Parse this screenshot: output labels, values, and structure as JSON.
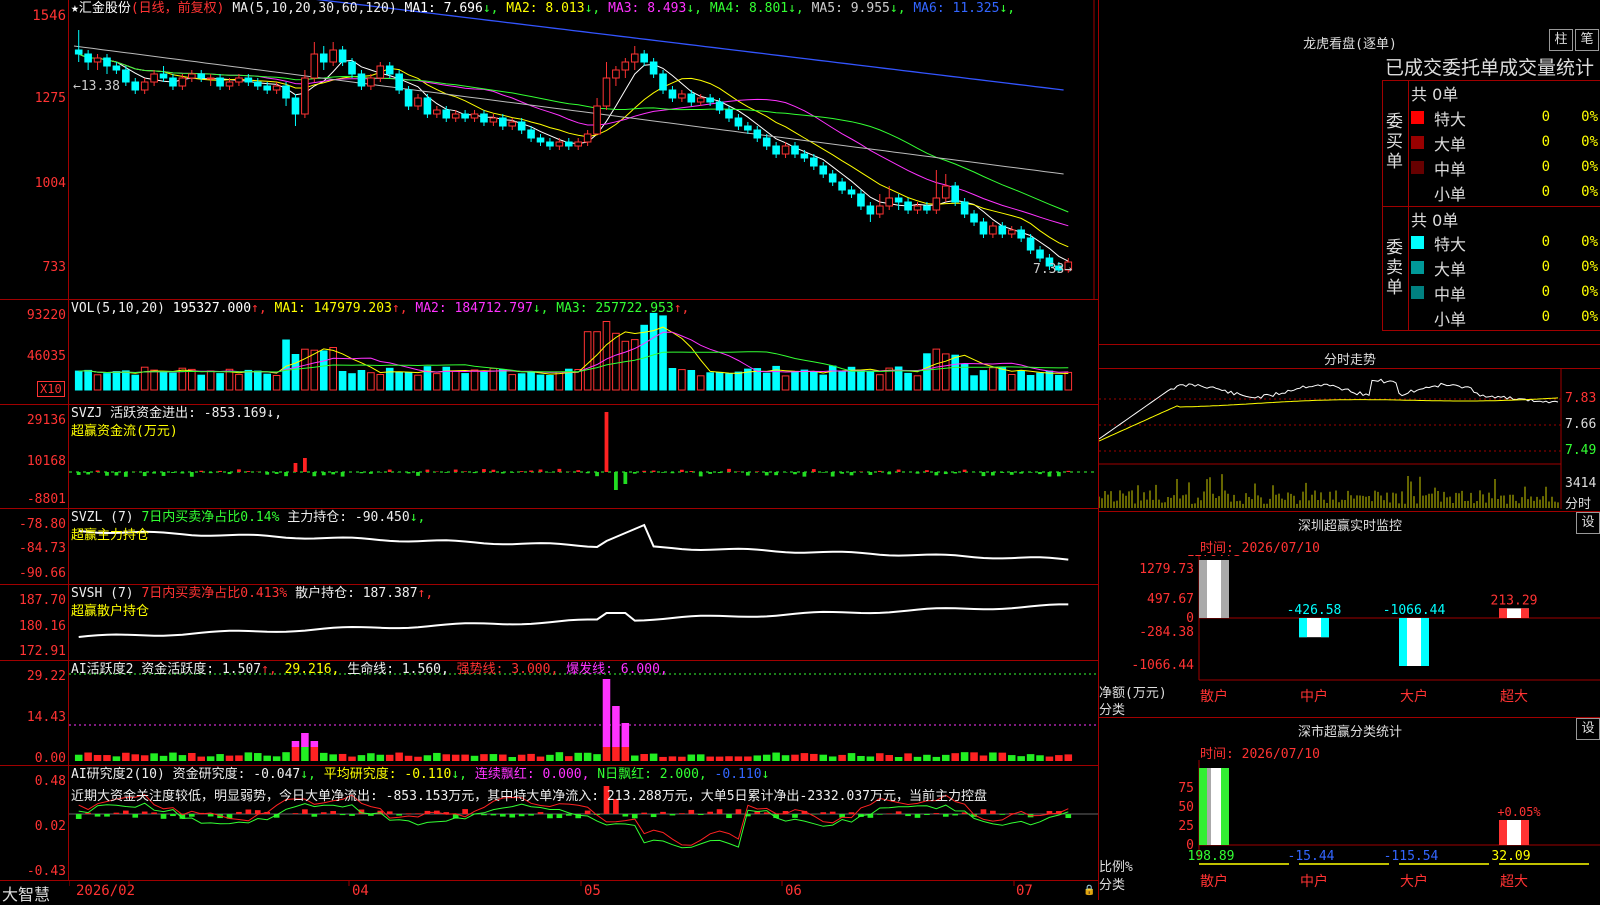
{
  "main_header": {
    "star": "★",
    "stock_name": "汇金股份",
    "period": "(日线，前复权)",
    "ma_params": "MA(5,10,20,30,60,120)",
    "ma": [
      {
        "label": "MA1: 7.696",
        "arrow": "↓",
        "color": "#ffffff"
      },
      {
        "label": "MA2: 8.013",
        "arrow": "↓",
        "color": "#ffff00"
      },
      {
        "label": "MA3: 8.493",
        "arrow": "↓",
        "color": "#ff33ff"
      },
      {
        "label": "MA4: 8.801",
        "arrow": "↓",
        "color": "#33ff33"
      },
      {
        "label": "MA5: 9.955",
        "arrow": "↓",
        "color": "#cccccc"
      },
      {
        "label": "MA6: 11.325",
        "arrow": "↓",
        "color": "#3366ff"
      }
    ],
    "y_ticks": [
      "1546",
      "1275",
      "1004",
      "733"
    ],
    "hi_label": "←13.38",
    "lo_label": "7.33→"
  },
  "vol_panel": {
    "title": "VOL(5,10,20)",
    "items": [
      {
        "label": " 195327.000",
        "arrow": "↑",
        "color": "#ffffff"
      },
      {
        "label": " MA1: 147979.203",
        "arrow": "↑",
        "color": "#ffff00"
      },
      {
        "label": " MA2: 184712.797",
        "arrow": "↓",
        "color": "#ff33ff"
      },
      {
        "label": " MA3: 257722.953",
        "arrow": "↑",
        "color": "#33ff33"
      }
    ],
    "y_ticks": [
      "93220",
      "46035"
    ],
    "unit": "X10"
  },
  "svzj_panel": {
    "title": "SVZJ  活跃资金进出: -853.169↓,",
    "subtitle": "超赢资金流(万元)",
    "y_ticks": [
      "29136",
      "10168",
      "-8801"
    ]
  },
  "svzl_panel": {
    "title_a": "SVZL (7) ",
    "title_b": "7日内买卖净占比0.14%",
    "title_c": " 主力持仓: -90.450",
    "arrow": "↓,",
    "subtitle": "超赢主力持仓",
    "y_ticks": [
      "-78.80",
      "-84.73",
      "-90.66"
    ]
  },
  "svsh_panel": {
    "title_a": "SVSH (7) ",
    "title_b": "7日内买卖净占比0.413%",
    "title_c": " 散户持仓: 187.387",
    "arrow": "↑,",
    "subtitle": "超赢散户持仓",
    "y_ticks": [
      "187.70",
      "180.16",
      "172.91"
    ]
  },
  "ai_active_panel": {
    "title": "AI活跃度2 资金活跃度: 1.507",
    "a1": "↑,",
    "v2": " 29.216,",
    "v3": " 生命线: 1.560,",
    "v4": " 强势线: 3.000,",
    "v5": " 爆发线: 6.000,",
    "y_ticks": [
      "29.22",
      "14.43",
      "0.00"
    ]
  },
  "ai_research_panel": {
    "title": "AI研究度2(10) 资金研究度: -0.047",
    "a1": "↓,",
    "p2": " 平均研究度: -0.110",
    "p3": " 连续飘红: 0.000,",
    "p4": " N日飘红: 2.000,",
    "p5": " -0.110",
    "summary": "近期大资金关注度较低，明显弱势，今日大单净流出: -853.153万元，其中特大单净流入: 213.288万元，大单5日累计净出-2332.037万元，当前主力控盘",
    "y_ticks": [
      "0.48",
      "0.02",
      "-0.43"
    ]
  },
  "x_axis": {
    "labels": [
      "2026/02",
      "04",
      "05",
      "06",
      "07"
    ],
    "brand": "大智慧"
  },
  "dragon_panel": {
    "title": "龙虎看盘(逐单)",
    "btn_pillar": "柱",
    "btn_pen": "笔",
    "subtitle": "已成交委托单成交量统计",
    "buy_label": "委买单",
    "sell_label": "委卖单",
    "buy_total": "共 0单",
    "sell_total": "共 0单",
    "buy_rows": [
      {
        "name": "特大",
        "count": "0",
        "pct": "0%",
        "color": "#ff0000"
      },
      {
        "name": "大单",
        "count": "0",
        "pct": "0%",
        "color": "#990000"
      },
      {
        "name": "中单",
        "count": "0",
        "pct": "0%",
        "color": "#660000"
      },
      {
        "name": "小单",
        "count": "0",
        "pct": "0%",
        "color": ""
      }
    ],
    "sell_rows": [
      {
        "name": "特大",
        "count": "0",
        "pct": "0%",
        "color": "#00ffff"
      },
      {
        "name": "大单",
        "count": "0",
        "pct": "0%",
        "color": "#009999"
      },
      {
        "name": "中单",
        "count": "0",
        "pct": "0%",
        "color": "#008080"
      },
      {
        "name": "小单",
        "count": "0",
        "pct": "0%",
        "color": ""
      }
    ]
  },
  "intraday_panel": {
    "title": "分时走势",
    "y_ticks": [
      "7.83",
      "7.66",
      "7.49"
    ],
    "vol_label": "3414",
    "vol_unit": "分时"
  },
  "monitor_panel": {
    "title": "深圳超赢实时监控",
    "settings": "设",
    "time_label": "时间: 2026/07/10",
    "y_ticks": [
      "1279.73",
      "497.67",
      "0",
      "-284.38",
      "-1066.44"
    ],
    "y_title": "净额(万元)",
    "x_title": "分类",
    "categories": [
      "散户",
      "中户",
      "大户",
      "超大"
    ],
    "values": [
      "1279.73",
      "-426.58",
      "-1066.44",
      "213.29"
    ]
  },
  "stats_panel": {
    "title": "深市超赢分类统计",
    "settings": "设",
    "time_label": "时间: 2026/07/10",
    "y_ticks": [
      "75",
      "50",
      "25",
      "0"
    ],
    "y_title": "比例%",
    "x_title": "分类",
    "categories": [
      "散户",
      "中户",
      "大户",
      "超大"
    ],
    "values": [
      "198.89",
      "-15.44",
      "-115.54",
      "32.09"
    ],
    "pct_label": "+0.05%"
  },
  "chart_data": {
    "type": "candlestick",
    "title": "汇金股份",
    "candles": [
      [
        12.9,
        12.8,
        13.4,
        12.6
      ],
      [
        12.8,
        12.6,
        12.9,
        12.4
      ],
      [
        12.6,
        12.7,
        12.8,
        12.4
      ],
      [
        12.7,
        12.5,
        12.8,
        12.3
      ],
      [
        12.5,
        12.4,
        12.6,
        12.3
      ],
      [
        12.4,
        12.1,
        12.5,
        12.0
      ],
      [
        12.1,
        11.9,
        12.2,
        11.8
      ],
      [
        11.9,
        12.1,
        12.2,
        11.8
      ],
      [
        12.1,
        12.3,
        12.4,
        12.0
      ],
      [
        12.3,
        12.2,
        12.5,
        12.1
      ],
      [
        12.2,
        12.0,
        12.3,
        11.9
      ],
      [
        12.0,
        12.2,
        12.3,
        11.9
      ],
      [
        12.2,
        12.3,
        12.4,
        12.1
      ],
      [
        12.3,
        12.2,
        12.4,
        12.1
      ],
      [
        12.2,
        12.2,
        12.3,
        12.0
      ],
      [
        12.2,
        12.0,
        12.3,
        11.9
      ],
      [
        12.0,
        12.1,
        12.2,
        11.9
      ],
      [
        12.1,
        12.2,
        12.3,
        12.0
      ],
      [
        12.2,
        12.1,
        12.3,
        12.0
      ],
      [
        12.1,
        12.0,
        12.2,
        11.9
      ],
      [
        12.0,
        11.9,
        12.1,
        11.8
      ],
      [
        11.9,
        12.0,
        12.1,
        11.8
      ],
      [
        12.0,
        11.7,
        12.1,
        11.5
      ],
      [
        11.7,
        11.3,
        11.8,
        11.0
      ],
      [
        11.3,
        12.2,
        12.4,
        11.2
      ],
      [
        12.2,
        12.8,
        13.1,
        12.1
      ],
      [
        12.8,
        12.6,
        13.0,
        12.4
      ],
      [
        12.6,
        12.9,
        13.1,
        12.5
      ],
      [
        12.9,
        12.6,
        13.0,
        12.5
      ],
      [
        12.6,
        12.3,
        12.7,
        12.2
      ],
      [
        12.3,
        12.0,
        12.4,
        11.9
      ],
      [
        12.0,
        12.2,
        12.3,
        11.9
      ],
      [
        12.2,
        12.5,
        12.6,
        12.1
      ],
      [
        12.5,
        12.3,
        12.6,
        12.2
      ],
      [
        12.3,
        11.9,
        12.4,
        11.8
      ],
      [
        11.9,
        11.5,
        12.0,
        11.4
      ],
      [
        11.5,
        11.7,
        11.8,
        11.4
      ],
      [
        11.7,
        11.3,
        11.8,
        11.2
      ],
      [
        11.3,
        11.4,
        11.5,
        11.2
      ],
      [
        11.4,
        11.2,
        11.5,
        11.1
      ],
      [
        11.2,
        11.3,
        11.4,
        11.1
      ],
      [
        11.3,
        11.2,
        11.4,
        11.1
      ],
      [
        11.2,
        11.3,
        11.4,
        11.1
      ],
      [
        11.3,
        11.1,
        11.4,
        11.0
      ],
      [
        11.1,
        11.2,
        11.3,
        11.0
      ],
      [
        11.2,
        11.0,
        11.3,
        10.9
      ],
      [
        11.0,
        11.1,
        11.2,
        10.9
      ],
      [
        11.1,
        10.9,
        11.2,
        10.8
      ],
      [
        10.9,
        10.7,
        11.0,
        10.6
      ],
      [
        10.7,
        10.6,
        10.8,
        10.5
      ],
      [
        10.6,
        10.5,
        10.7,
        10.4
      ],
      [
        10.5,
        10.6,
        10.7,
        10.4
      ],
      [
        10.6,
        10.5,
        10.7,
        10.4
      ],
      [
        10.5,
        10.6,
        10.7,
        10.4
      ],
      [
        10.6,
        10.8,
        10.9,
        10.5
      ],
      [
        10.8,
        11.5,
        11.7,
        10.8
      ],
      [
        11.5,
        12.2,
        12.6,
        11.4
      ],
      [
        12.2,
        12.4,
        12.5,
        12.0
      ],
      [
        12.4,
        12.6,
        12.7,
        12.2
      ],
      [
        12.6,
        12.8,
        13.0,
        12.4
      ],
      [
        12.8,
        12.6,
        12.9,
        12.5
      ],
      [
        12.6,
        12.3,
        12.7,
        12.2
      ],
      [
        12.3,
        11.9,
        12.4,
        11.8
      ],
      [
        11.9,
        11.7,
        12.0,
        11.6
      ],
      [
        11.7,
        11.8,
        11.9,
        11.6
      ],
      [
        11.8,
        11.6,
        11.9,
        11.5
      ],
      [
        11.6,
        11.7,
        11.8,
        11.5
      ],
      [
        11.7,
        11.6,
        11.8,
        11.5
      ],
      [
        11.6,
        11.4,
        11.7,
        11.3
      ],
      [
        11.4,
        11.2,
        11.5,
        11.1
      ],
      [
        11.2,
        11.0,
        11.3,
        10.9
      ],
      [
        11.0,
        10.9,
        11.1,
        10.8
      ],
      [
        10.9,
        10.7,
        11.0,
        10.6
      ],
      [
        10.7,
        10.5,
        10.8,
        10.4
      ],
      [
        10.5,
        10.3,
        10.6,
        10.2
      ],
      [
        10.3,
        10.5,
        10.6,
        10.2
      ],
      [
        10.5,
        10.3,
        10.6,
        10.2
      ],
      [
        10.3,
        10.2,
        10.4,
        10.1
      ],
      [
        10.2,
        10.0,
        10.3,
        9.9
      ],
      [
        10.0,
        9.8,
        10.1,
        9.7
      ],
      [
        9.8,
        9.6,
        9.9,
        9.5
      ],
      [
        9.6,
        9.4,
        9.7,
        9.3
      ],
      [
        9.4,
        9.3,
        9.5,
        9.2
      ],
      [
        9.3,
        9.0,
        9.4,
        8.9
      ],
      [
        9.0,
        8.8,
        9.1,
        8.6
      ],
      [
        8.8,
        9.0,
        9.3,
        8.7
      ],
      [
        9.0,
        9.2,
        9.5,
        8.9
      ],
      [
        9.2,
        9.1,
        9.3,
        8.9
      ],
      [
        9.1,
        8.9,
        9.2,
        8.8
      ],
      [
        8.9,
        9.0,
        9.1,
        8.8
      ],
      [
        9.0,
        8.9,
        9.1,
        8.8
      ],
      [
        8.9,
        9.2,
        9.9,
        8.8
      ],
      [
        9.2,
        9.5,
        9.8,
        9.1
      ],
      [
        9.5,
        9.1,
        9.6,
        9.0
      ],
      [
        9.1,
        8.8,
        9.2,
        8.7
      ],
      [
        8.8,
        8.6,
        8.9,
        8.5
      ],
      [
        8.6,
        8.3,
        8.7,
        8.2
      ],
      [
        8.3,
        8.5,
        8.6,
        8.2
      ],
      [
        8.5,
        8.3,
        8.6,
        8.2
      ],
      [
        8.3,
        8.4,
        8.5,
        8.2
      ],
      [
        8.4,
        8.2,
        8.5,
        8.1
      ],
      [
        8.2,
        7.9,
        8.3,
        7.8
      ],
      [
        7.9,
        7.7,
        8.0,
        7.6
      ],
      [
        7.7,
        7.5,
        7.8,
        7.4
      ],
      [
        7.5,
        7.4,
        7.6,
        7.33
      ],
      [
        7.4,
        7.6,
        7.7,
        7.33
      ]
    ],
    "price_range": [
      7.33,
      13.38
    ]
  }
}
